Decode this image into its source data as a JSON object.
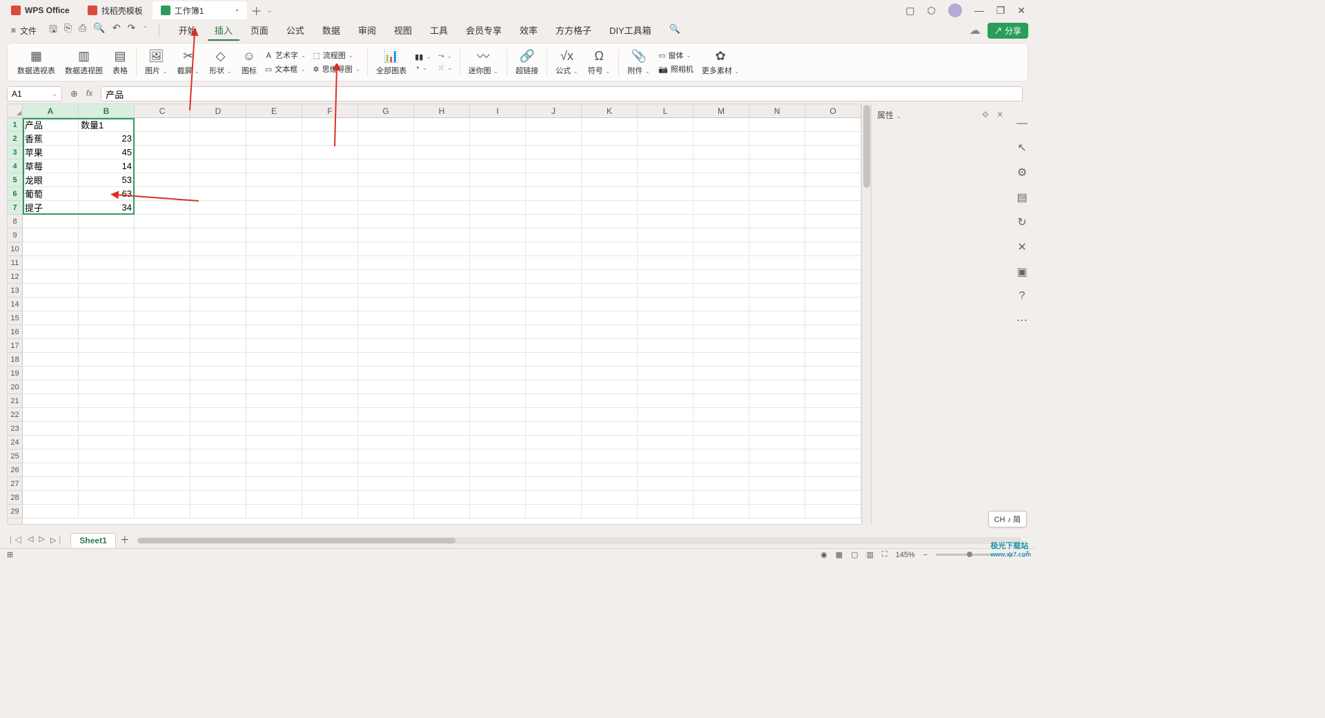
{
  "tabs": {
    "office": "WPS Office",
    "docer": "找稻壳模板",
    "workbook": "工作簿1"
  },
  "file_label": "文件",
  "menu": {
    "start": "开始",
    "insert": "插入",
    "page": "页面",
    "formula": "公式",
    "data": "数据",
    "review": "审阅",
    "view": "视图",
    "tools": "工具",
    "member": "会员专享",
    "efficiency": "效率",
    "fanggezi": "方方格子",
    "diy": "DIY工具箱"
  },
  "share_label": "分享",
  "ribbon": {
    "pivot": "数据透视表",
    "pivotchart": "数据透视图",
    "table": "表格",
    "picture": "图片",
    "screenshot": "截屏",
    "shape": "形状",
    "icon": "图标",
    "wordart": "艺术字",
    "textbox": "文本框",
    "flowchart": "流程图",
    "mindmap": "思维导图",
    "allcharts": "全部图表",
    "sparkline": "迷你图",
    "hyperlink": "超链接",
    "equation": "公式",
    "symbol": "符号",
    "attachment": "附件",
    "form": "窗体",
    "camera": "照相机",
    "more": "更多素材"
  },
  "cellref": "A1",
  "formula_value": "产品",
  "panel": {
    "title": "属性"
  },
  "columns": [
    "A",
    "B",
    "C",
    "D",
    "E",
    "F",
    "G",
    "H",
    "I",
    "J",
    "K",
    "L",
    "M",
    "N",
    "O"
  ],
  "sheet": {
    "name": "Sheet1"
  },
  "zoom": "145%",
  "ime": "CH ♪ 简",
  "watermark": {
    "name": "极光下载站",
    "url": "www.xz7.com"
  },
  "chart_data": {
    "type": "table",
    "headers": [
      "产品",
      "数量1"
    ],
    "rows": [
      {
        "product": "香蕉",
        "qty": 23
      },
      {
        "product": "苹果",
        "qty": 45
      },
      {
        "product": "草莓",
        "qty": 14
      },
      {
        "product": "龙眼",
        "qty": 53
      },
      {
        "product": "葡萄",
        "qty": 63
      },
      {
        "product": "提子",
        "qty": 34
      }
    ]
  }
}
